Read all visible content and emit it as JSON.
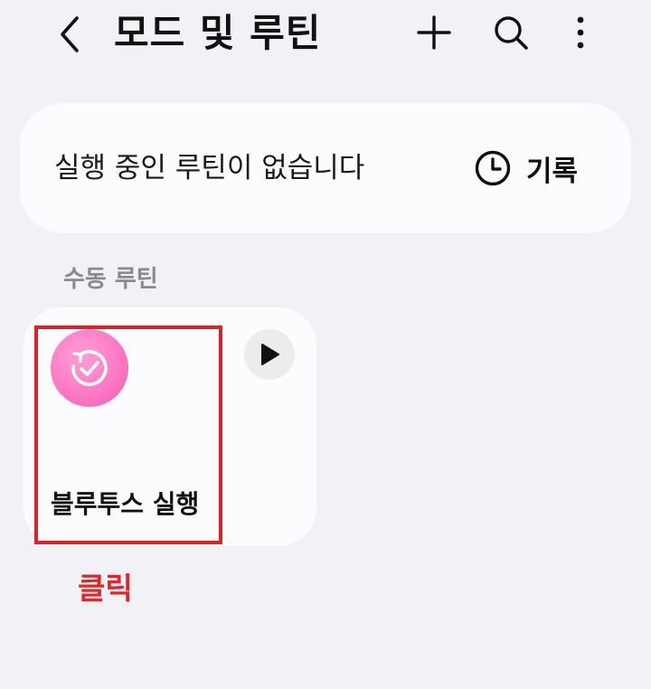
{
  "header": {
    "title": "모드 및 루틴",
    "back_icon": "chevron-left-icon",
    "add_icon": "plus-icon",
    "search_icon": "search-icon",
    "more_icon": "more-vertical-icon"
  },
  "status_card": {
    "text": "실행 중인 루틴이 없습니다",
    "history_label": "기록",
    "history_icon": "clock-icon"
  },
  "section": {
    "label": "수동 루틴"
  },
  "routines": [
    {
      "name": "블루투스 실행",
      "icon": "routine-check-icon",
      "icon_color": "#fb6fc0",
      "play_icon": "play-icon"
    }
  ],
  "annotation": {
    "text": "클릭",
    "color": "#e0262b",
    "highlight_color": "#d8232a"
  },
  "colors": {
    "background": "#f2f1f5",
    "card": "#fcfcfe"
  }
}
